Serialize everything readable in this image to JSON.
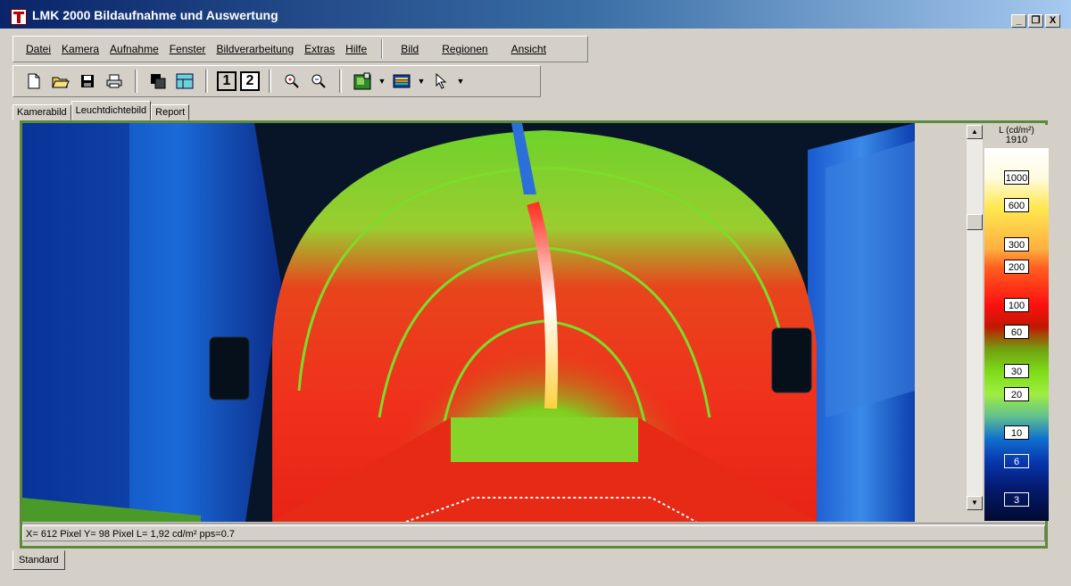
{
  "window": {
    "title": "LMK 2000 Bildaufnahme und Auswertung",
    "controls": [
      "_",
      "❐",
      "X"
    ]
  },
  "menu": {
    "items": [
      "Datei",
      "Kamera",
      "Aufnahme",
      "Fenster",
      "Bildverarbeitung",
      "Extras",
      "Hilfe"
    ],
    "right_items": [
      "Bild",
      "Regionen",
      "Ansicht"
    ]
  },
  "toolbar": {
    "icons": [
      "new-icon",
      "open-icon",
      "save-icon",
      "print-icon",
      "copy-window-icon",
      "layout-icon",
      "view-1",
      "view-2",
      "zoom-in-icon",
      "zoom-out-icon",
      "camera-image-icon",
      "palette-icon",
      "pointer-icon"
    ],
    "view_1_label": "1",
    "view_2_label": "2"
  },
  "tabs": [
    {
      "label": "Kamerabild"
    },
    {
      "label": "Leuchtdichtebild",
      "active": true
    },
    {
      "label": "Report"
    }
  ],
  "legend": {
    "title": "L (cd/m²)",
    "top_value": "1910",
    "ticks": [
      "1000",
      "600",
      "300",
      "200",
      "100",
      "60",
      "30",
      "20",
      "10",
      "6",
      "3"
    ]
  },
  "status": {
    "text": "X= 612 Pixel  Y= 98 Pixel  L= 1,92 cd/m²  pps=0.7"
  },
  "bottom_tab": {
    "label": "Standard"
  },
  "colors": {
    "title_bar_start": "#0a246a",
    "title_bar_end": "#a6caf0",
    "panel_border": "#5d8a3a",
    "window_face": "#d4d0c8"
  }
}
